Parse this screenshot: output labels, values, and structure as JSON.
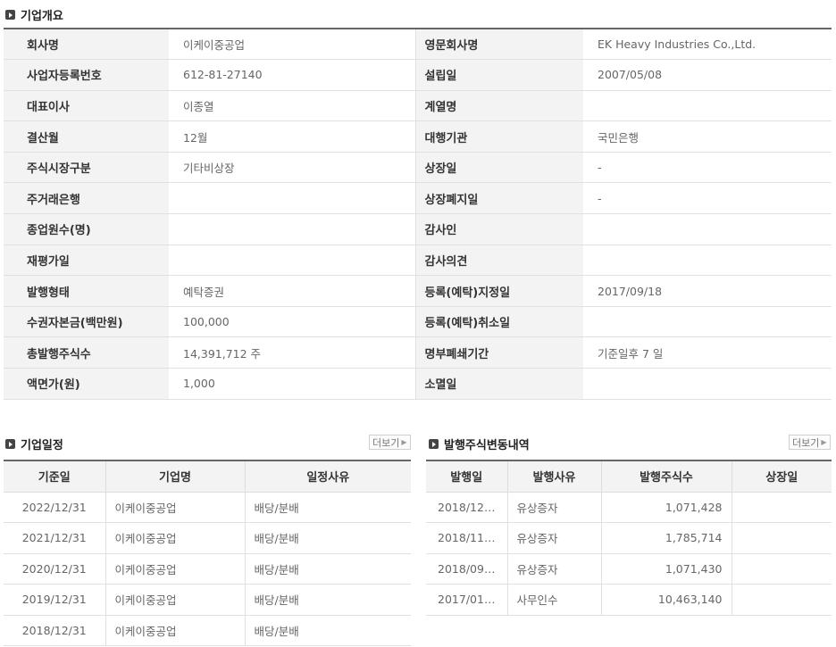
{
  "overview": {
    "title": "기업개요",
    "rows": [
      [
        {
          "label": "회사명",
          "value": "이케이중공업"
        },
        {
          "label": "영문회사명",
          "value": "EK Heavy Industries Co.,Ltd."
        }
      ],
      [
        {
          "label": "사업자등록번호",
          "value": "612-81-27140"
        },
        {
          "label": "설립일",
          "value": "2007/05/08"
        }
      ],
      [
        {
          "label": "대표이사",
          "value": "이종열"
        },
        {
          "label": "계열명",
          "value": ""
        }
      ],
      [
        {
          "label": "결산월",
          "value": "12월"
        },
        {
          "label": "대행기관",
          "value": "국민은행"
        }
      ],
      [
        {
          "label": "주식시장구분",
          "value": "기타비상장"
        },
        {
          "label": "상장일",
          "value": "-"
        }
      ],
      [
        {
          "label": "주거래은행",
          "value": ""
        },
        {
          "label": "상장폐지일",
          "value": "-"
        }
      ],
      [
        {
          "label": "종업원수(명)",
          "value": ""
        },
        {
          "label": "감사인",
          "value": ""
        }
      ],
      [
        {
          "label": "재평가일",
          "value": ""
        },
        {
          "label": "감사의견",
          "value": ""
        }
      ],
      [
        {
          "label": "발행형태",
          "value": "예탁증권"
        },
        {
          "label": "등록(예탁)지정일",
          "value": "2017/09/18"
        }
      ],
      [
        {
          "label": "수권자본금(백만원)",
          "value": "100,000"
        },
        {
          "label": "등록(예탁)취소일",
          "value": ""
        }
      ],
      [
        {
          "label": "총발행주식수",
          "value": "14,391,712 주"
        },
        {
          "label": "명부폐쇄기간",
          "value": "기준일후 7 일"
        }
      ],
      [
        {
          "label": "액면가(원)",
          "value": "1,000"
        },
        {
          "label": "소멸일",
          "value": ""
        }
      ]
    ]
  },
  "schedule": {
    "title": "기업일정",
    "more_label": "더보기",
    "headers": [
      "기준일",
      "기업명",
      "일정사유"
    ],
    "rows": [
      [
        "2022/12/31",
        "이케이중공업",
        "배당/분배"
      ],
      [
        "2021/12/31",
        "이케이중공업",
        "배당/분배"
      ],
      [
        "2020/12/31",
        "이케이중공업",
        "배당/분배"
      ],
      [
        "2019/12/31",
        "이케이중공업",
        "배당/분배"
      ],
      [
        "2018/12/31",
        "이케이중공업",
        "배당/분배"
      ]
    ]
  },
  "issues": {
    "title": "발행주식변동내역",
    "more_label": "더보기",
    "headers": [
      "발행일",
      "발행사유",
      "발행주식수",
      "상장일"
    ],
    "rows": [
      [
        "2018/12…",
        "유상증자",
        "1,071,428",
        ""
      ],
      [
        "2018/11…",
        "유상증자",
        "1,785,714",
        ""
      ],
      [
        "2018/09…",
        "유상증자",
        "1,071,430",
        ""
      ],
      [
        "2017/01…",
        "사무인수",
        "10,463,140",
        ""
      ]
    ]
  }
}
